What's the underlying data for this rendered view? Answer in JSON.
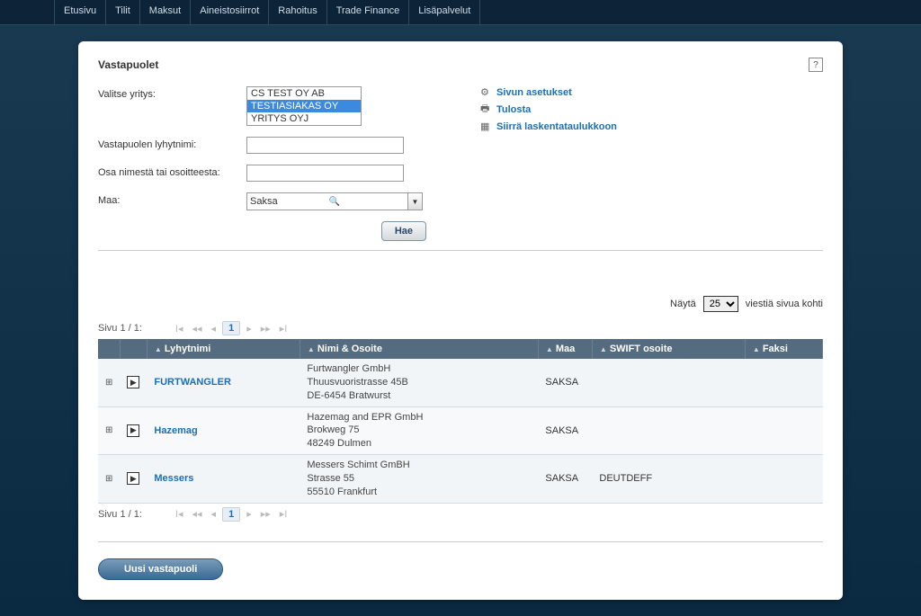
{
  "nav": [
    "Etusivu",
    "Tilit",
    "Maksut",
    "Aineistosiirrot",
    "Rahoitus",
    "Trade Finance",
    "Lisäpalvelut"
  ],
  "page_title": "Vastapuolet",
  "help_icon": "?",
  "labels": {
    "select_company": "Valitse yritys:",
    "short_name": "Vastapuolen lyhytnimi:",
    "name_address": "Osa nimestä tai osoitteesta:",
    "country": "Maa:"
  },
  "companies": {
    "options": [
      "CS TEST OY AB",
      "TESTIASIAKAS OY",
      "YRITYS OYJ"
    ],
    "selected_index": 1
  },
  "inputs": {
    "short_name": "",
    "name_address": ""
  },
  "country_value": "Saksa",
  "actions": {
    "page_settings": "Sivun asetukset",
    "print": "Tulosta",
    "export_spreadsheet": "Siirrä laskentataulukkoon"
  },
  "search_button": "Hae",
  "per_page": {
    "label": "Näytä",
    "value": "25",
    "suffix": "viestiä sivua kohti"
  },
  "pager": {
    "label": "Sivu 1 / 1:",
    "current": "1"
  },
  "columns": {
    "short": "Lyhytnimi",
    "name_addr": "Nimi & Osoite",
    "country": "Maa",
    "swift": "SWIFT osoite",
    "fax": "Faksi"
  },
  "rows": [
    {
      "short": "FURTWANGLER",
      "addr": [
        "Furtwangler GmbH",
        "Thuusvuoristrasse 45B",
        "DE-6454 Bratwurst"
      ],
      "country": "SAKSA",
      "swift": "",
      "fax": ""
    },
    {
      "short": "Hazemag",
      "addr": [
        "Hazemag and EPR GmbH",
        "Brokweg 75",
        "48249 Dulmen"
      ],
      "country": "SAKSA",
      "swift": "",
      "fax": ""
    },
    {
      "short": "Messers",
      "addr": [
        "Messers Schimt GmBH",
        "Strasse 55",
        "55510 Frankfurt"
      ],
      "country": "SAKSA",
      "swift": "DEUTDEFF",
      "fax": ""
    }
  ],
  "new_button": "Uusi vastapuoli"
}
